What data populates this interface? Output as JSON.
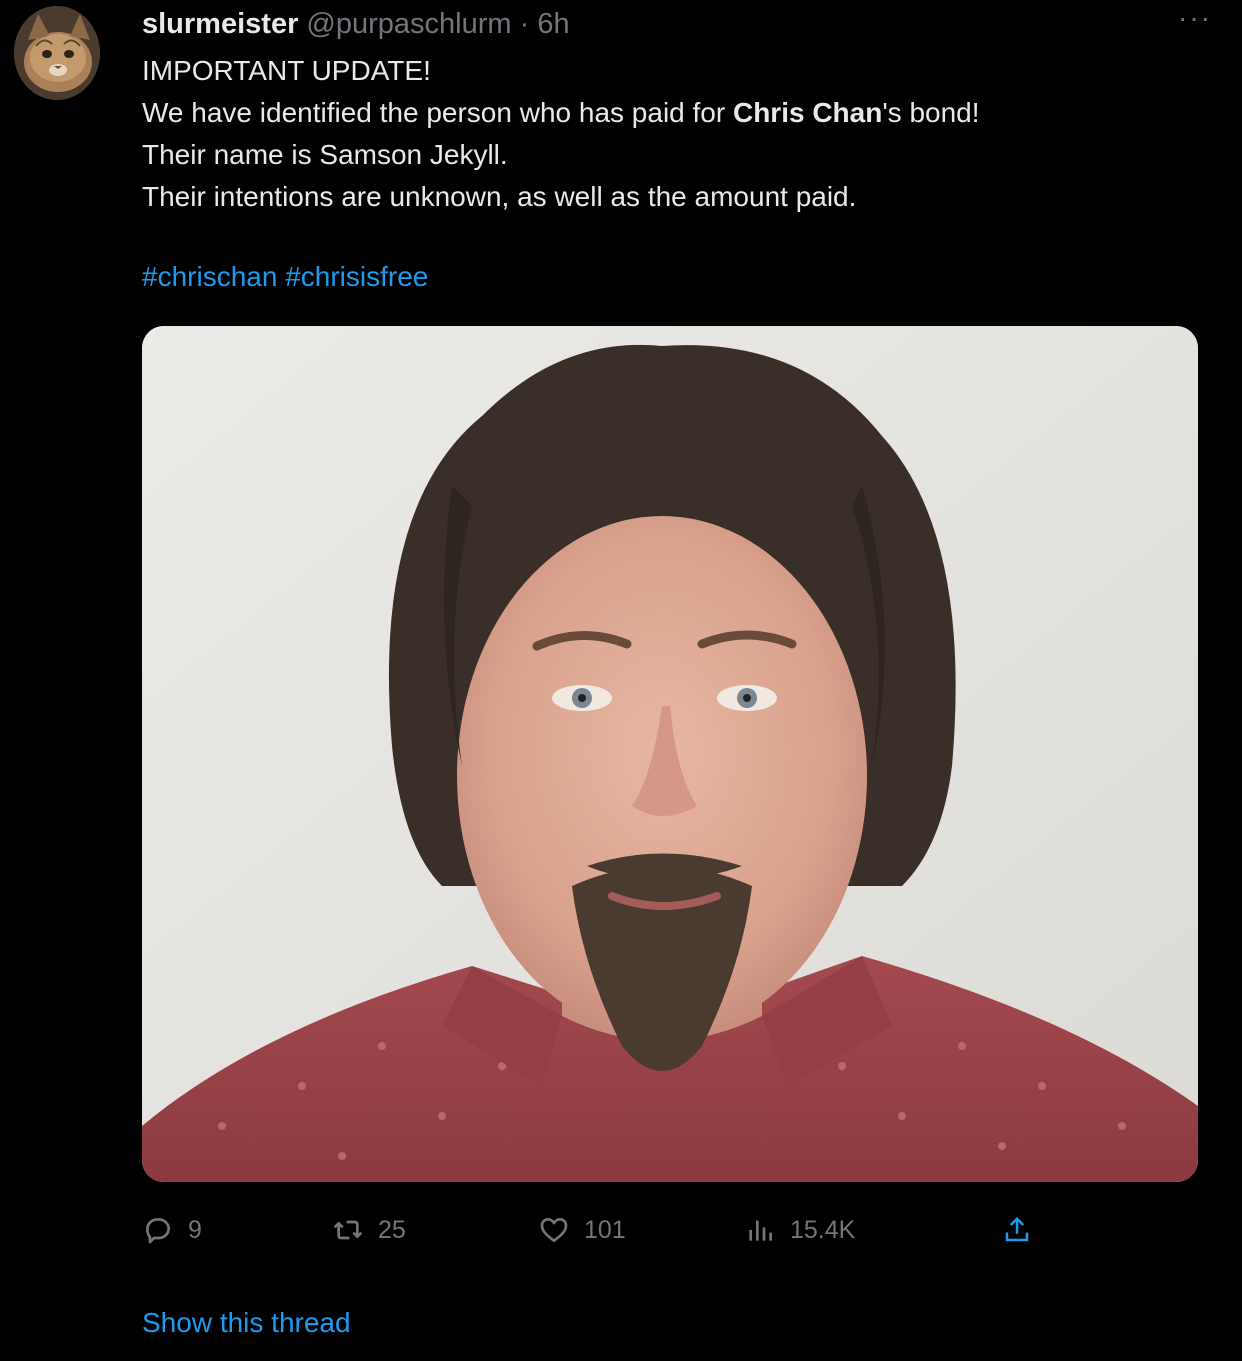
{
  "tweet": {
    "display_name": "slurmeister",
    "handle": "@purpaschlurm",
    "separator": "·",
    "time": "6h",
    "more_label": "···",
    "text": {
      "line1": "IMPORTANT UPDATE!",
      "line2_pre": "We have identified the person who has paid for ",
      "line2_bold": "Chris Chan",
      "line2_post": "'s bond!",
      "line3": "Their name is Samson Jekyll.",
      "line4": "Their intentions are unknown, as well as the amount paid."
    },
    "hashtags": [
      "#chrischan",
      "#chrisisfree"
    ],
    "stats": {
      "replies": "9",
      "retweets": "25",
      "likes": "101",
      "views": "15.4K"
    },
    "show_thread": "Show this thread"
  },
  "icons": {
    "avatar": "cat-avatar",
    "more": "more-dots-icon",
    "reply": "reply-icon",
    "retweet": "retweet-icon",
    "like": "heart-icon",
    "views": "views-chart-icon",
    "share": "share-icon"
  },
  "colors": {
    "background": "#000000",
    "text": "#e7e9ea",
    "muted": "#71767b",
    "link": "#1d9bf0"
  }
}
